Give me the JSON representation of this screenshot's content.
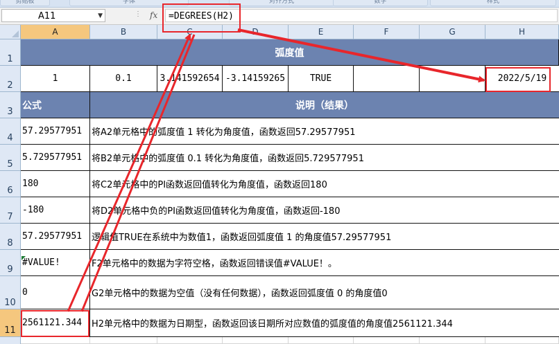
{
  "ribbon": {
    "groups": [
      "剪贴板",
      "字体",
      "对齐方式",
      "数字",
      "样式"
    ]
  },
  "formula_bar": {
    "name_box": "A11",
    "fx_label": "fx",
    "formula": "=DEGREES(H2)"
  },
  "columns": [
    "A",
    "B",
    "C",
    "D",
    "E",
    "F",
    "G",
    "H"
  ],
  "rows": [
    "1",
    "2",
    "3",
    "4",
    "5",
    "6",
    "7",
    "8",
    "9",
    "10",
    "11"
  ],
  "sheet": {
    "title": "弧度值",
    "row2": [
      "1",
      "0.1",
      "3.141592654",
      "-3.14159265",
      "TRUE",
      "",
      "",
      "2022/5/19"
    ],
    "header_formula": "公式",
    "header_desc": "说明（结果）",
    "results": [
      {
        "value": "57.29577951",
        "desc": "将A2单元格中的弧度值 1 转化为角度值，函数返回57.29577951"
      },
      {
        "value": "5.729577951",
        "desc": "将B2单元格中的弧度值 0.1 转化为角度值，函数返回5.729577951"
      },
      {
        "value": "180",
        "desc": "将C2单元格中的PI函数返回值转化为角度值，函数返回180"
      },
      {
        "value": "-180",
        "desc": "将D2单元格中负的PI函数返回值转化为角度值，函数返回-180"
      },
      {
        "value": "57.29577951",
        "desc": "逻辑值TRUE在系统中为数值1，函数返回弧度值 1 的角度值57.29577951"
      },
      {
        "value": "#VALUE!",
        "desc": "F2单元格中的数据为字符空格，函数返回错误值#VALUE！。"
      },
      {
        "value": "0",
        "desc": "G2单元格中的数据为空值（没有任何数据），函数返回弧度值 0 的角度值0"
      },
      {
        "value": "2561121.344",
        "desc": "H2单元格中的数据为日期型，函数返回该日期所对应数值的弧度值的角度值2561121.344"
      }
    ]
  },
  "colors": {
    "header_fill": "#6c83b0",
    "annotation": "#e8262b",
    "selected_header": "#f5c77e"
  }
}
